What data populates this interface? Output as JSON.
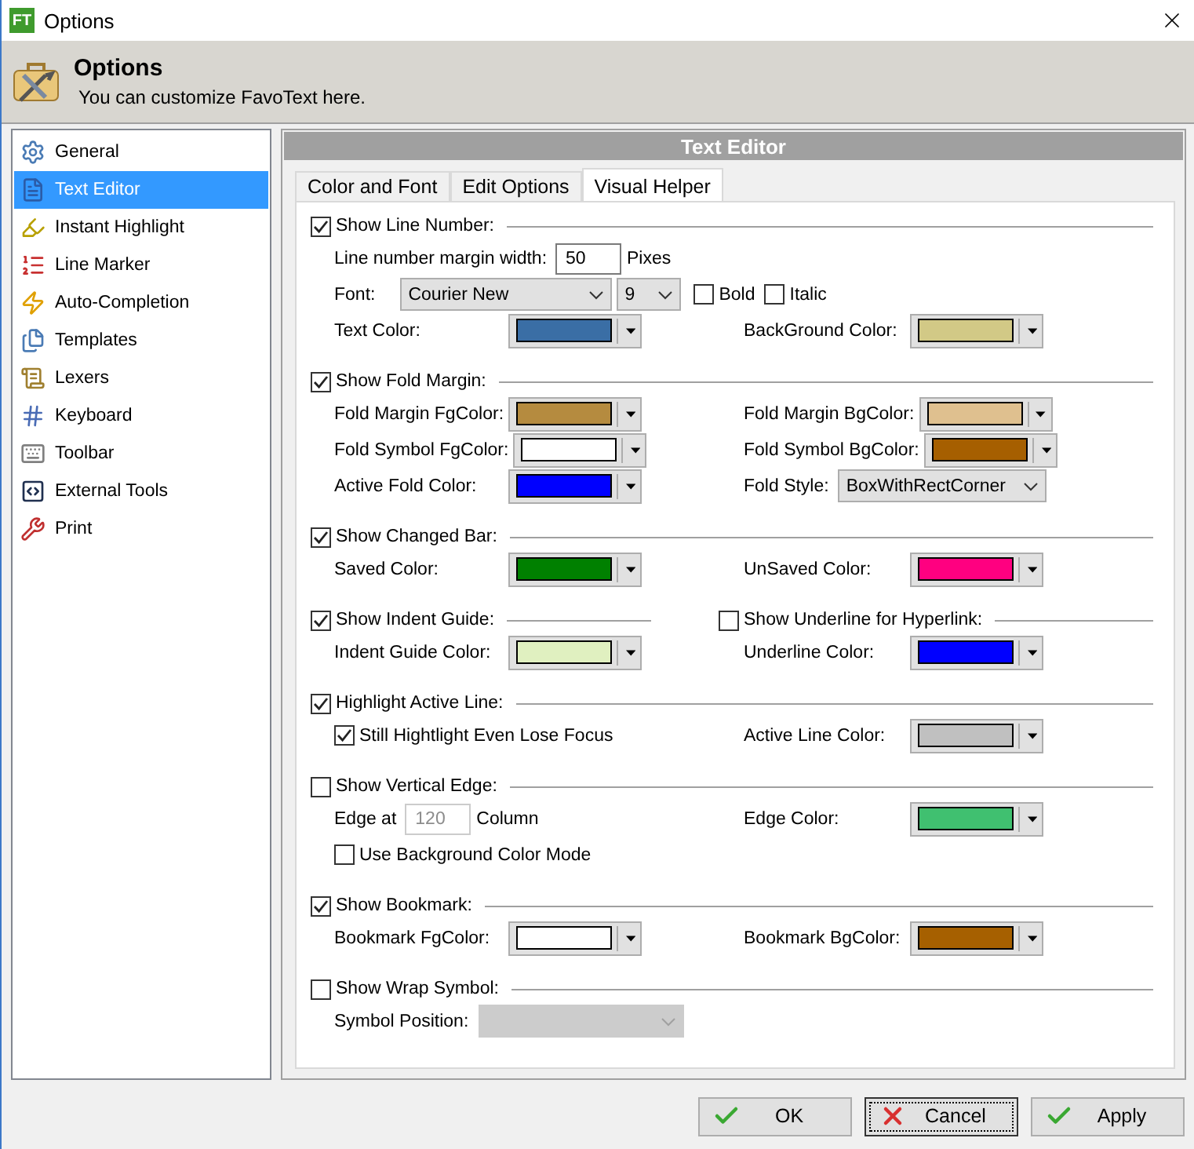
{
  "window": {
    "app_icon": "FT",
    "title": "Options"
  },
  "header": {
    "title": "Options",
    "subtitle": "You can customize FavoText here."
  },
  "sidebar": {
    "items": [
      {
        "label": "General",
        "selected": false
      },
      {
        "label": "Text Editor",
        "selected": true
      },
      {
        "label": "Instant Highlight",
        "selected": false
      },
      {
        "label": "Line Marker",
        "selected": false
      },
      {
        "label": "Auto-Completion",
        "selected": false
      },
      {
        "label": "Templates",
        "selected": false
      },
      {
        "label": "Lexers",
        "selected": false
      },
      {
        "label": "Keyboard",
        "selected": false
      },
      {
        "label": "Toolbar",
        "selected": false
      },
      {
        "label": "External Tools",
        "selected": false
      },
      {
        "label": "Print",
        "selected": false
      }
    ]
  },
  "panel": {
    "title": "Text Editor",
    "tabs": [
      {
        "label": "Color and Font",
        "selected": false
      },
      {
        "label": "Edit Options",
        "selected": false
      },
      {
        "label": "Visual Helper",
        "selected": true
      }
    ],
    "sections": [
      {
        "groups": [
          {
            "label": "Show Line Number:",
            "checked": true,
            "rows": [
              [
                {
                  "kind": "number",
                  "label": "Line number margin width:",
                  "value": "50",
                  "unit": "Pixes",
                  "disabled": false
                }
              ],
              [
                {
                  "kind": "font",
                  "label": "Font:",
                  "font": "Courier New",
                  "size": "9",
                  "options": [
                    {
                      "label": "Bold",
                      "checked": false
                    },
                    {
                      "label": "Italic",
                      "checked": false
                    }
                  ]
                }
              ],
              [
                {
                  "kind": "color",
                  "label": "Text Color:",
                  "color": "#3a6ea5"
                },
                {
                  "kind": "color",
                  "label": "BackGround Color:",
                  "color": "#d2c986"
                }
              ]
            ]
          }
        ]
      },
      {
        "groups": [
          {
            "label": "Show Fold Margin:",
            "checked": true,
            "rows": [
              [
                {
                  "kind": "color",
                  "label": "Fold Margin FgColor:",
                  "color": "#b58b3f"
                },
                {
                  "kind": "color",
                  "label": "Fold Margin BgColor:",
                  "color": "#dfc08f"
                }
              ],
              [
                {
                  "kind": "color",
                  "label": "Fold Symbol FgColor:",
                  "color": "#ffffff"
                },
                {
                  "kind": "color",
                  "label": "Fold Symbol BgColor:",
                  "color": "#a65f00"
                }
              ],
              [
                {
                  "kind": "color",
                  "label": "Active Fold Color:",
                  "color": "#0000ff"
                },
                {
                  "kind": "select",
                  "label": "Fold Style:",
                  "value": "BoxWithRectCorner",
                  "disabled": false
                }
              ]
            ]
          }
        ]
      },
      {
        "groups": [
          {
            "label": "Show Changed Bar:",
            "checked": true,
            "rows": [
              [
                {
                  "kind": "color",
                  "label": "Saved Color:",
                  "color": "#008000"
                },
                {
                  "kind": "color",
                  "label": "UnSaved Color:",
                  "color": "#ff0080"
                }
              ]
            ]
          }
        ]
      },
      {
        "groups": [
          {
            "label": "Show Indent Guide:",
            "checked": true,
            "rows": [
              [
                {
                  "kind": "color",
                  "label": "Indent Guide Color:",
                  "color": "#e0f0c0"
                }
              ]
            ]
          },
          {
            "label": "Show Underline for Hyperlink:",
            "checked": false,
            "rows": [
              [
                {
                  "kind": "color",
                  "label": "Underline Color:",
                  "color": "#0000ff"
                }
              ]
            ]
          }
        ]
      },
      {
        "groups": [
          {
            "label": "Highlight Active Line:",
            "checked": true,
            "rows": [
              [
                {
                  "kind": "checkbox",
                  "label": "Still Hightlight Even Lose Focus",
                  "checked": true
                },
                {
                  "kind": "color",
                  "label": "Active Line Color:",
                  "color": "#c0c0c0"
                }
              ]
            ]
          }
        ]
      },
      {
        "groups": [
          {
            "label": "Show Vertical Edge:",
            "checked": false,
            "rows": [
              [
                {
                  "kind": "number",
                  "label": "Edge at",
                  "value": "120",
                  "unit": "Column",
                  "disabled": true
                },
                {
                  "kind": "color",
                  "label": "Edge Color:",
                  "color": "#40c070"
                }
              ],
              [
                {
                  "kind": "checkbox",
                  "label": "Use Background Color Mode",
                  "checked": false
                }
              ]
            ]
          }
        ]
      },
      {
        "groups": [
          {
            "label": "Show Bookmark:",
            "checked": true,
            "rows": [
              [
                {
                  "kind": "color",
                  "label": "Bookmark FgColor:",
                  "color": "#ffffff"
                },
                {
                  "kind": "color",
                  "label": "Bookmark BgColor:",
                  "color": "#a66000"
                }
              ]
            ]
          }
        ]
      },
      {
        "groups": [
          {
            "label": "Show Wrap Symbol:",
            "checked": false,
            "rows": [
              [
                {
                  "kind": "select",
                  "label": "Symbol Position:",
                  "disabled": true
                }
              ]
            ]
          }
        ]
      }
    ]
  },
  "buttons": [
    {
      "label": "OK",
      "kind": "accept",
      "focused": false
    },
    {
      "label": "Cancel",
      "kind": "reject",
      "focused": true
    },
    {
      "label": "Apply",
      "kind": "accept",
      "focused": false
    }
  ]
}
